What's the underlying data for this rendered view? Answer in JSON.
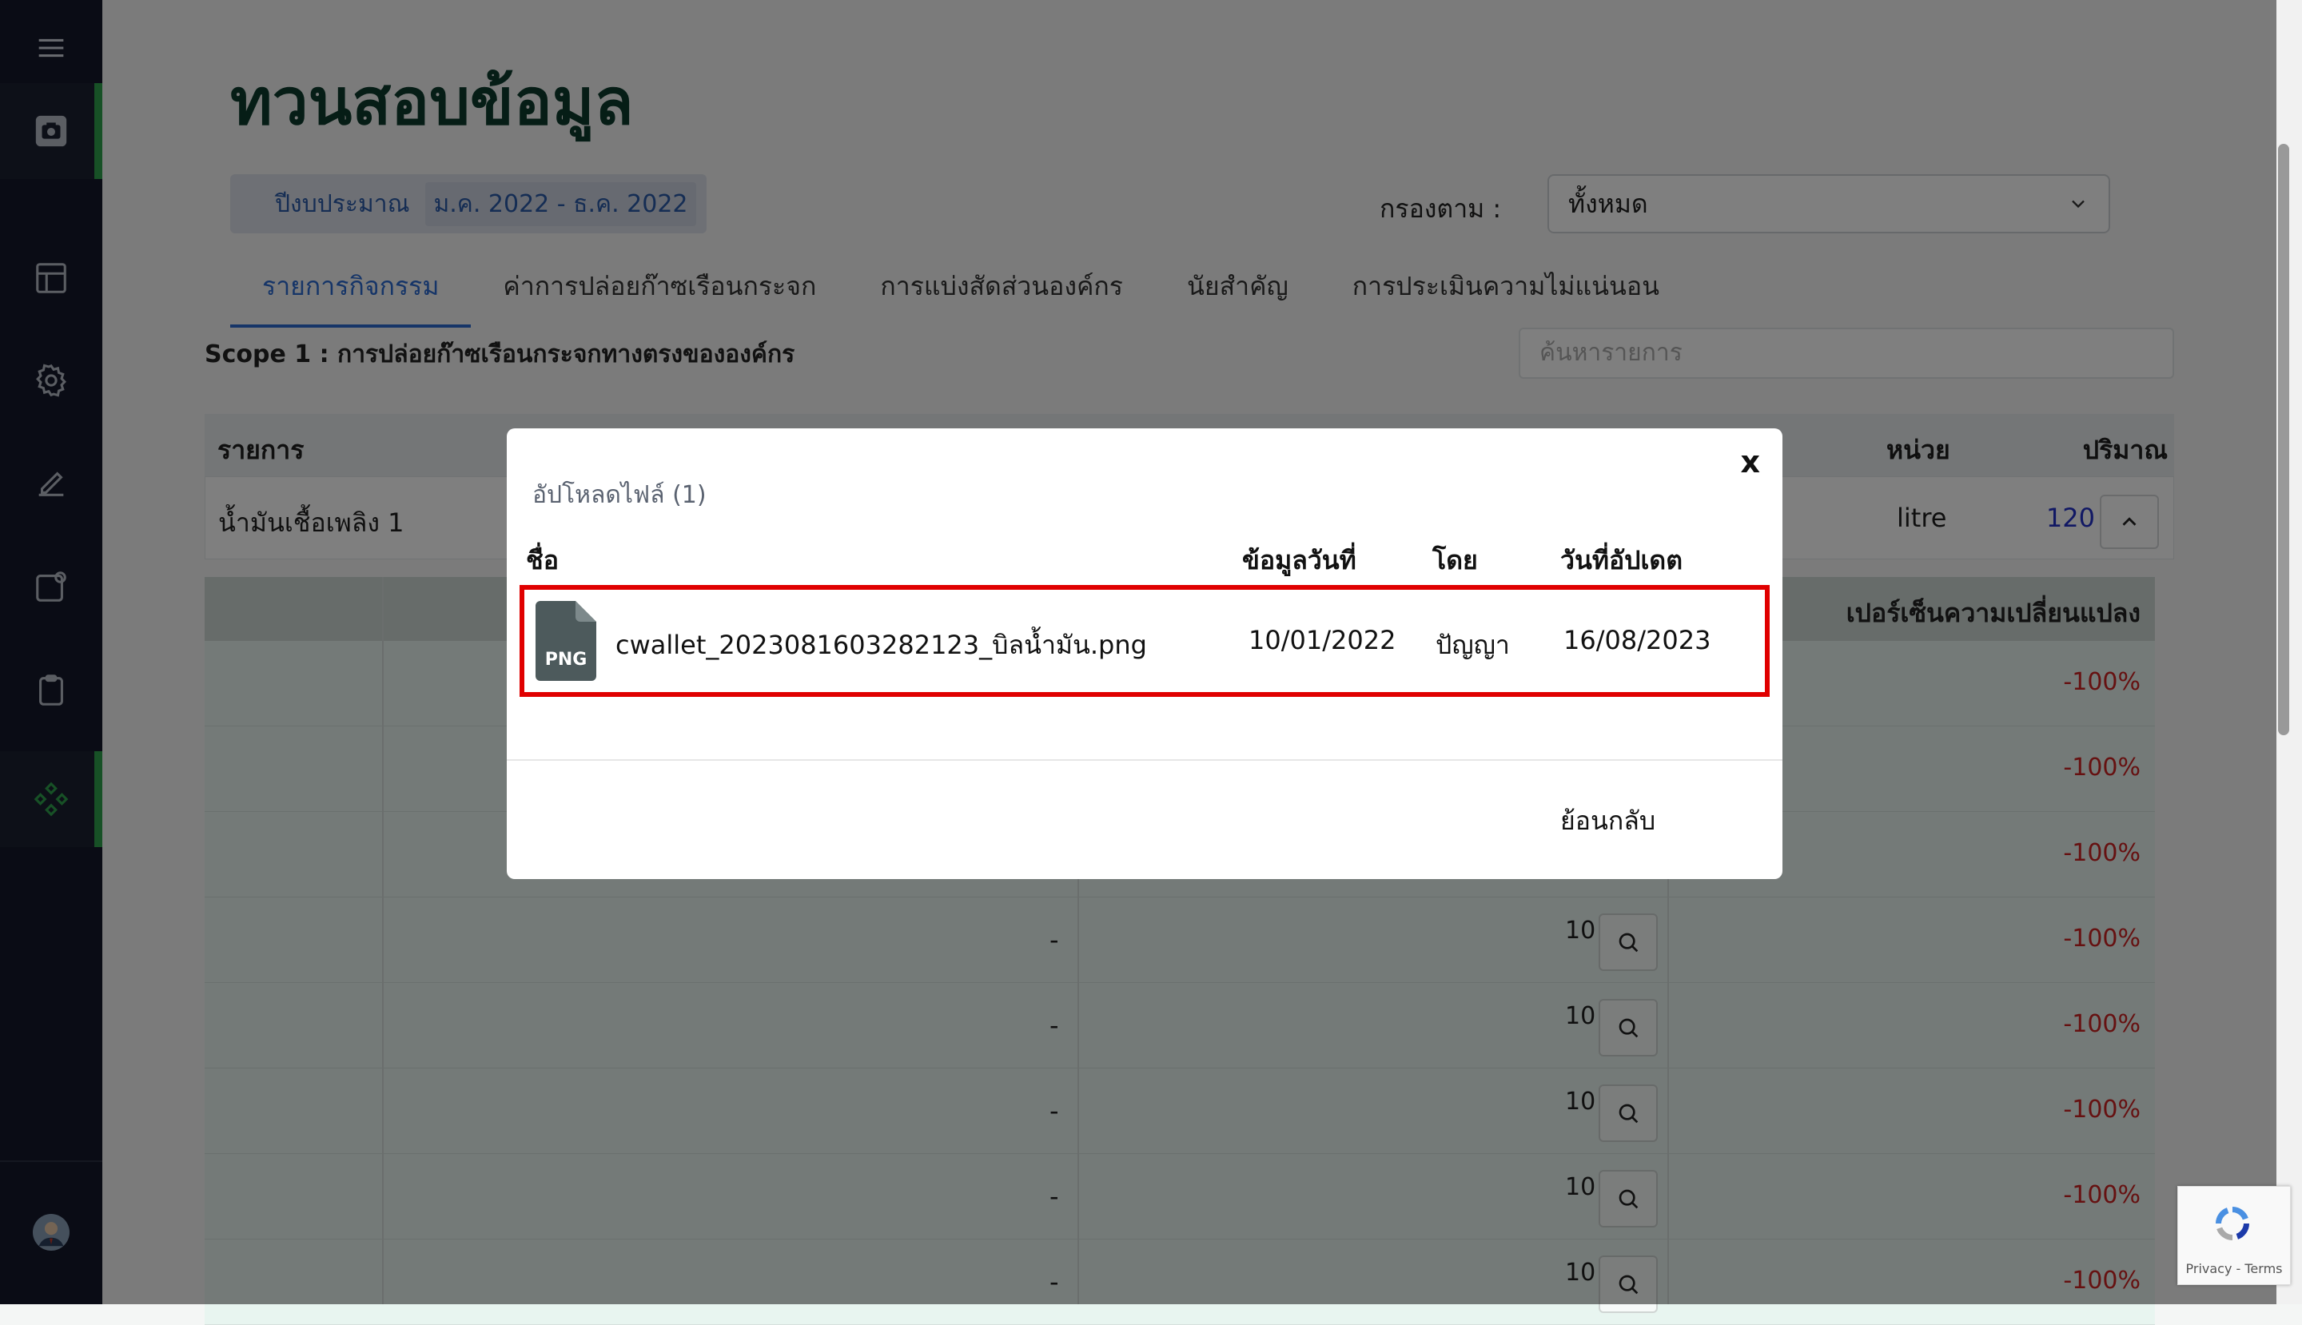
{
  "page": {
    "title": "ทวนสอบข้อมูล",
    "budget_label": "ปีงบประมาณ",
    "budget_value": "ม.ค. 2022 - ธ.ค. 2022",
    "filter_label": "กรองตาม  :",
    "filter_value": "ทั้งหมด",
    "tabs": [
      "รายการกิจกรรม",
      "ค่าการปล่อยก๊าซเรือนกระจก",
      "การแบ่งสัดส่วนองค์กร",
      "นัยสำคัญ",
      "การประเมินความไม่แน่นอน"
    ],
    "scope_title": "Scope 1 : การปล่อยก๊าซเรือนกระจกทางตรงขององค์กร",
    "search_placeholder": "ค้นหารายการ"
  },
  "table": {
    "headers": {
      "item": "รายการ",
      "unit": "หน่วย",
      "amount": "ปริมาณ"
    },
    "row": {
      "item": "น้ำมันเชื้อเพลิง 1",
      "unit": "litre",
      "amount": "120"
    }
  },
  "sub_table": {
    "header": "เปอร์เซ็นความเปลี่ยนแปลง",
    "rows": [
      {
        "dash": "",
        "qty": "",
        "pct": "-100%"
      },
      {
        "dash": "",
        "qty": "",
        "pct": "-100%"
      },
      {
        "dash": "",
        "qty": "",
        "pct": "-100%"
      },
      {
        "dash": "-",
        "qty": "10",
        "pct": "-100%"
      },
      {
        "dash": "-",
        "qty": "10",
        "pct": "-100%"
      },
      {
        "dash": "-",
        "qty": "10",
        "pct": "-100%"
      },
      {
        "dash": "-",
        "qty": "10",
        "pct": "-100%"
      },
      {
        "dash": "-",
        "qty": "10",
        "pct": "-100%"
      }
    ]
  },
  "modal": {
    "title": "อัปโหลดไฟล์ (1)",
    "close": "x",
    "headers": {
      "name": "ชื่อ",
      "data_date": "ข้อมูลวันที่",
      "by": "โดย",
      "updated": "วันที่อัปเดต"
    },
    "file": {
      "icon_label": "PNG",
      "name": "cwallet_2023081603282123_บิลน้ำมัน.png",
      "data_date": "10/01/2022",
      "by": "ปัญญา",
      "updated": "16/08/2023"
    },
    "back": "ย้อนกลับ"
  },
  "recaptcha": {
    "text": "Privacy - Terms"
  },
  "colors": {
    "sidebar": "#14182a",
    "accent_green": "#2fa34c",
    "tab_blue": "#2c6bd0",
    "negative_red": "#cc2222",
    "highlight": "#e00000"
  }
}
